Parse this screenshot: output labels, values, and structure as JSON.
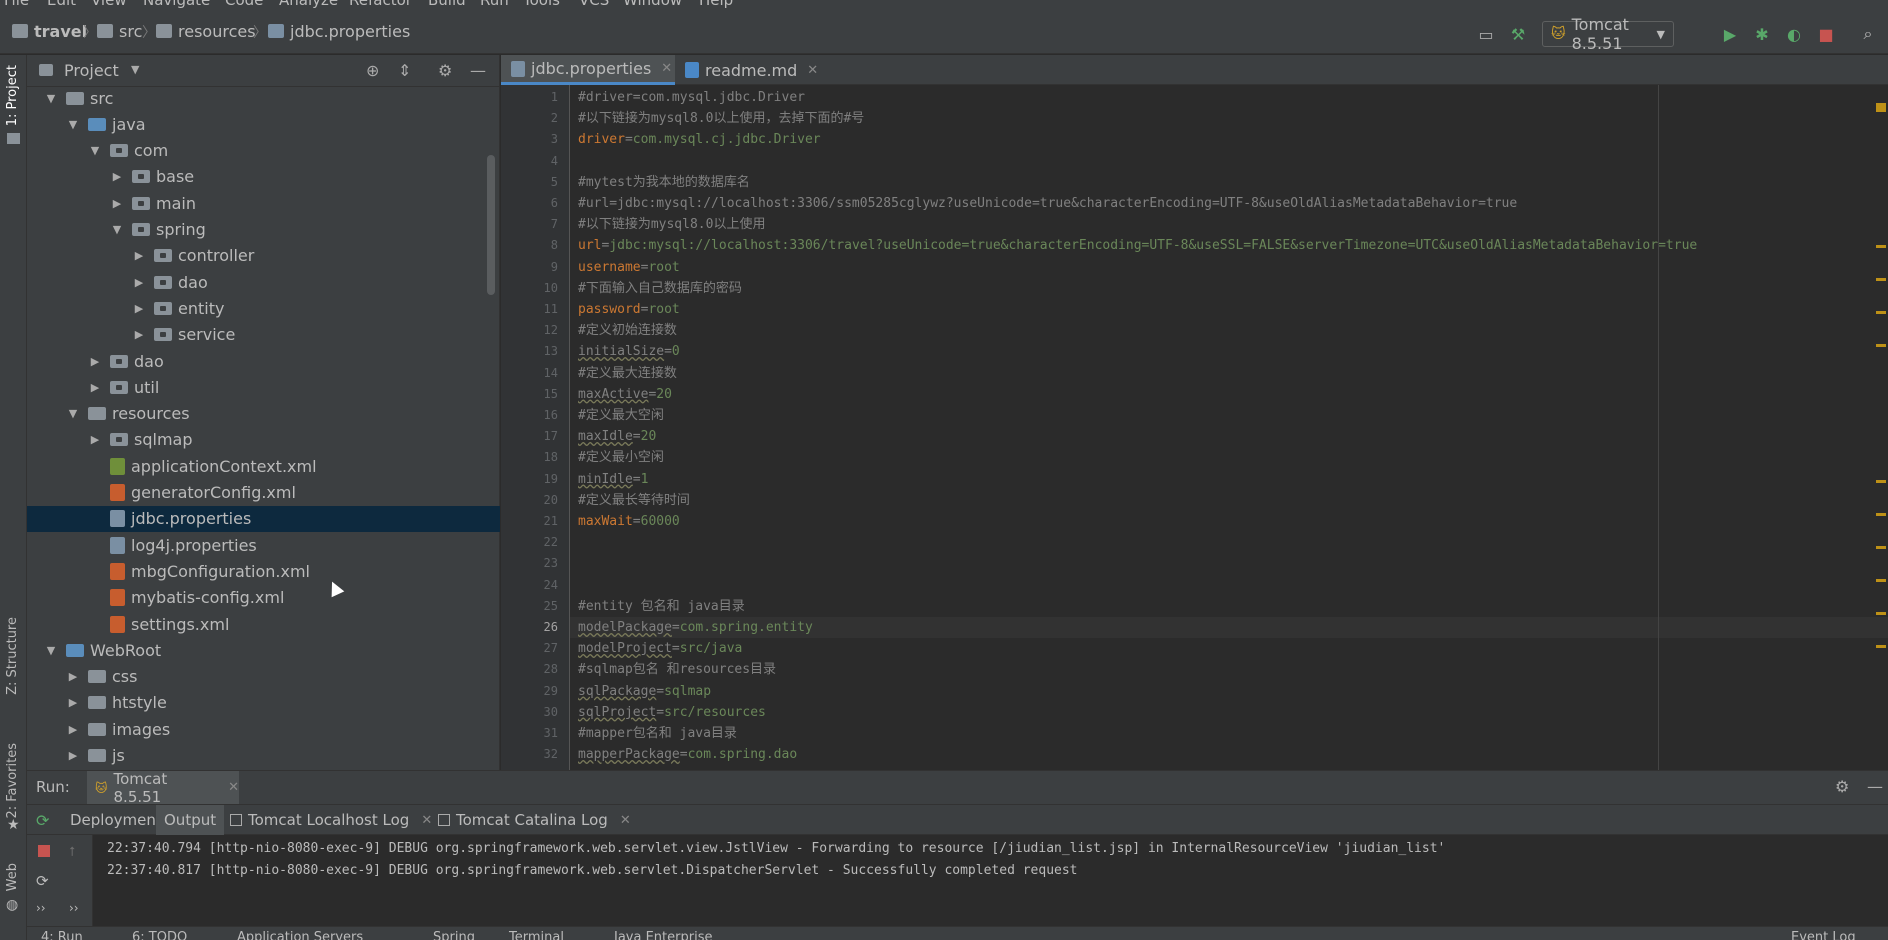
{
  "menu": [
    "File",
    "Edit",
    "View",
    "Navigate",
    "Code",
    "Analyze",
    "Refactor",
    "Build",
    "Run",
    "Tools",
    "VCS",
    "Window",
    "Help"
  ],
  "breadcrumb": {
    "project": "travel",
    "folder1": "src",
    "folder2": "resources",
    "file": "jdbc.properties"
  },
  "run_config": {
    "label": "Tomcat 8.5.51"
  },
  "left_strip": {
    "project": "1: Project",
    "structure": "Z: Structure",
    "favorites": "2: Favorites",
    "web": "Web"
  },
  "project_panel": {
    "title": "Project",
    "tree": [
      {
        "label": "src",
        "depth": 1,
        "kind": "folder",
        "arrow": "open"
      },
      {
        "label": "java",
        "depth": 2,
        "kind": "folder-blue",
        "arrow": "open"
      },
      {
        "label": "com",
        "depth": 3,
        "kind": "package",
        "arrow": "open"
      },
      {
        "label": "base",
        "depth": 4,
        "kind": "package",
        "arrow": "closed"
      },
      {
        "label": "main",
        "depth": 4,
        "kind": "package",
        "arrow": "closed"
      },
      {
        "label": "spring",
        "depth": 4,
        "kind": "package",
        "arrow": "open"
      },
      {
        "label": "controller",
        "depth": 5,
        "kind": "package",
        "arrow": "closed"
      },
      {
        "label": "dao",
        "depth": 5,
        "kind": "package",
        "arrow": "closed"
      },
      {
        "label": "entity",
        "depth": 5,
        "kind": "package",
        "arrow": "closed"
      },
      {
        "label": "service",
        "depth": 5,
        "kind": "package",
        "arrow": "closed"
      },
      {
        "label": "dao",
        "depth": 3,
        "kind": "package",
        "arrow": "closed"
      },
      {
        "label": "util",
        "depth": 3,
        "kind": "package",
        "arrow": "closed"
      },
      {
        "label": "resources",
        "depth": 2,
        "kind": "folder-res",
        "arrow": "open"
      },
      {
        "label": "sqlmap",
        "depth": 3,
        "kind": "package",
        "arrow": "closed"
      },
      {
        "label": "applicationContext.xml",
        "depth": 3,
        "kind": "xml-green",
        "arrow": "none"
      },
      {
        "label": "generatorConfig.xml",
        "depth": 3,
        "kind": "xml",
        "arrow": "none"
      },
      {
        "label": "jdbc.properties",
        "depth": 3,
        "kind": "prop",
        "arrow": "none",
        "selected": true
      },
      {
        "label": "log4j.properties",
        "depth": 3,
        "kind": "prop",
        "arrow": "none"
      },
      {
        "label": "mbgConfiguration.xml",
        "depth": 3,
        "kind": "xml",
        "arrow": "none"
      },
      {
        "label": "mybatis-config.xml",
        "depth": 3,
        "kind": "xml",
        "arrow": "none"
      },
      {
        "label": "settings.xml",
        "depth": 3,
        "kind": "xml",
        "arrow": "none"
      },
      {
        "label": "WebRoot",
        "depth": 1,
        "kind": "folder-blue",
        "arrow": "open"
      },
      {
        "label": "css",
        "depth": 2,
        "kind": "folder",
        "arrow": "closed"
      },
      {
        "label": "htstyle",
        "depth": 2,
        "kind": "folder",
        "arrow": "closed"
      },
      {
        "label": "images",
        "depth": 2,
        "kind": "folder",
        "arrow": "closed"
      },
      {
        "label": "js",
        "depth": 2,
        "kind": "folder",
        "arrow": "closed"
      }
    ]
  },
  "editor": {
    "tabs": [
      {
        "label": "jdbc.properties",
        "active": true
      },
      {
        "label": "readme.md",
        "active": false
      }
    ],
    "current_line": 26,
    "lines": [
      {
        "n": "1",
        "type": "comment",
        "text": "#driver=com.mysql.jdbc.Driver"
      },
      {
        "n": "2",
        "type": "comment",
        "text": "#以下链接为mysql8.0以上使用，去掉下面的#号"
      },
      {
        "n": "3",
        "type": "kv",
        "key": "driver",
        "value": "com.mysql.cj.jdbc.Driver",
        "warn": false
      },
      {
        "n": "4",
        "type": "blank",
        "text": ""
      },
      {
        "n": "5",
        "type": "comment",
        "text": "#mytest为我本地的数据库名"
      },
      {
        "n": "6",
        "type": "comment",
        "text": "#url=jdbc:mysql://localhost:3306/ssm05285cglywz?useUnicode=true&characterEncoding=UTF-8&useOldAliasMetadataBehavior=true"
      },
      {
        "n": "7",
        "type": "comment",
        "text": "#以下链接为mysql8.0以上使用"
      },
      {
        "n": "8",
        "type": "kv",
        "key": "url",
        "value": "jdbc:mysql://localhost:3306/travel?useUnicode=true&characterEncoding=UTF-8&useSSL=FALSE&serverTimezone=UTC&useOldAliasMetadataBehavior=true",
        "warn": false
      },
      {
        "n": "9",
        "type": "kv",
        "key": "username",
        "value": "root",
        "warn": false
      },
      {
        "n": "10",
        "type": "comment",
        "text": "#下面输入自己数据库的密码"
      },
      {
        "n": "11",
        "type": "kv",
        "key": "password",
        "value": "root",
        "warn": false
      },
      {
        "n": "12",
        "type": "comment",
        "text": "#定义初始连接数"
      },
      {
        "n": "13",
        "type": "kv",
        "key": "initialSize",
        "value": "0",
        "warn": true
      },
      {
        "n": "14",
        "type": "comment",
        "text": "#定义最大连接数"
      },
      {
        "n": "15",
        "type": "kv",
        "key": "maxActive",
        "value": "20",
        "warn": true
      },
      {
        "n": "16",
        "type": "comment",
        "text": "#定义最大空闲"
      },
      {
        "n": "17",
        "type": "kv",
        "key": "maxIdle",
        "value": "20",
        "warn": true
      },
      {
        "n": "18",
        "type": "comment",
        "text": "#定义最小空闲"
      },
      {
        "n": "19",
        "type": "kv",
        "key": "minIdle",
        "value": "1",
        "warn": true
      },
      {
        "n": "20",
        "type": "comment",
        "text": "#定义最长等待时间"
      },
      {
        "n": "21",
        "type": "kv",
        "key": "maxWait",
        "value": "60000",
        "warn": false
      },
      {
        "n": "22",
        "type": "blank",
        "text": ""
      },
      {
        "n": "23",
        "type": "blank",
        "text": ""
      },
      {
        "n": "24",
        "type": "blank",
        "text": ""
      },
      {
        "n": "25",
        "type": "comment",
        "text": "#entity 包名和 java目录"
      },
      {
        "n": "26",
        "type": "kv",
        "key": "modelPackage",
        "value": "com.spring.entity",
        "warn": true
      },
      {
        "n": "27",
        "type": "kv",
        "key": "modelProject",
        "value": "src/java",
        "warn": true
      },
      {
        "n": "28",
        "type": "comment",
        "text": "#sqlmap包名 和resources目录"
      },
      {
        "n": "29",
        "type": "kv",
        "key": "sqlPackage",
        "value": "sqlmap",
        "warn": true
      },
      {
        "n": "30",
        "type": "kv",
        "key": "sqlProject",
        "value": "src/resources",
        "warn": true
      },
      {
        "n": "31",
        "type": "comment",
        "text": "#mapper包名和 java目录"
      },
      {
        "n": "32",
        "type": "kv",
        "key": "mapperPackage",
        "value": "com.spring.dao",
        "warn": true
      }
    ]
  },
  "run_panel": {
    "label": "Run:",
    "config_tab": "Tomcat 8.5.51",
    "tabs": [
      "Deployment",
      "Output",
      "Tomcat Localhost Log",
      "Tomcat Catalina Log"
    ],
    "active_tab": "Output",
    "console": [
      "22:37:40.794 [http-nio-8080-exec-9] DEBUG org.springframework.web.servlet.view.JstlView - Forwarding to resource [/jiudian_list.jsp] in InternalResourceView 'jiudian_list'",
      "22:37:40.817 [http-nio-8080-exec-9] DEBUG org.springframework.web.servlet.DispatcherServlet - Successfully completed request"
    ]
  },
  "bottom_bar": [
    "4: Run",
    "6: TODO",
    "Application Servers",
    "Spring",
    "Terminal",
    "Java Enterprise",
    "Event Log"
  ],
  "colors": {
    "accent": "#4a88c7",
    "selection": "#0d293e",
    "keyword": "#cc7832",
    "string": "#6a8759",
    "comment": "#808080"
  }
}
